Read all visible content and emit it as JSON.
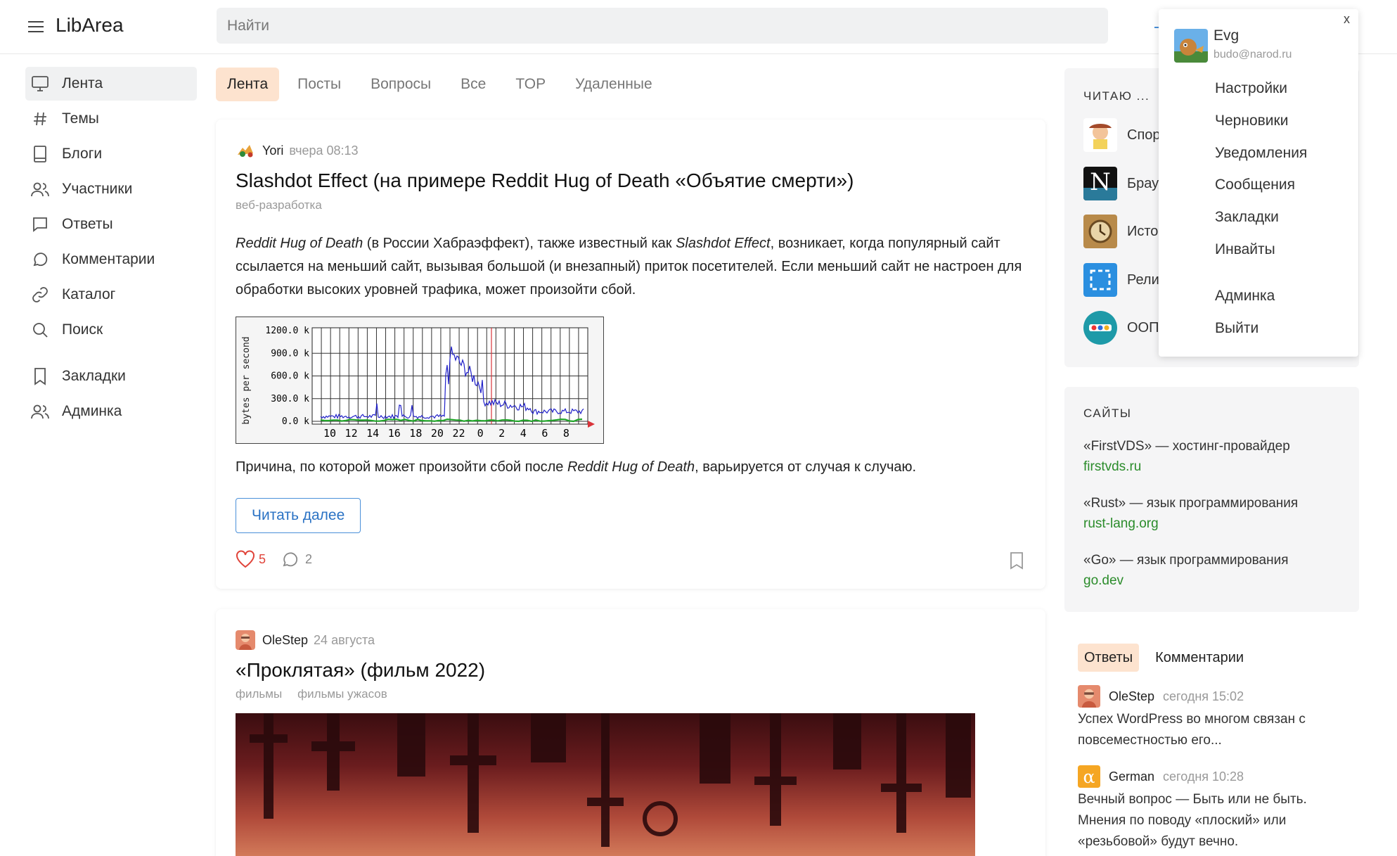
{
  "header": {
    "logo": "LibArea",
    "search_placeholder": "Найти"
  },
  "nav": [
    {
      "label": "Лента",
      "icon": "monitor-icon",
      "active": true
    },
    {
      "label": "Темы",
      "icon": "hash-icon"
    },
    {
      "label": "Блоги",
      "icon": "book-icon"
    },
    {
      "label": "Участники",
      "icon": "users-icon"
    },
    {
      "label": "Ответы",
      "icon": "message-square-icon"
    },
    {
      "label": "Комментарии",
      "icon": "message-circle-icon"
    },
    {
      "label": "Каталог",
      "icon": "link-icon"
    },
    {
      "label": "Поиск",
      "icon": "search-icon"
    },
    {
      "label": "Закладки",
      "icon": "bookmark-icon"
    },
    {
      "label": "Админка",
      "icon": "users-icon"
    }
  ],
  "tabs": [
    "Лента",
    "Посты",
    "Вопросы",
    "Все",
    "TOP",
    "Удаленные"
  ],
  "post1": {
    "author": "Yori",
    "date": "вчера 08:13",
    "title": "Slashdot Effect (на примере Reddit Hug of Death «Объятие смерти»)",
    "tag": "веб-разработка",
    "p1_em1": "Reddit Hug of Death",
    "p1_t1": " (в России Хабраэффект), также известный как ",
    "p1_em2": "Slashdot Effect",
    "p1_t2": ", возникает, когда популярный сайт ссылается на меньший сайт, вызывая большой (и внезапный) приток посетителей. Если меньший сайт не настроен для обработки высоких уровней трафика, может произойти сбой.",
    "p2_t1": "Причина, по которой может произойти сбой после ",
    "p2_em": "Reddit Hug of Death",
    "p2_t2": ", варьируется от случая к случаю.",
    "read_more": "Читать далее",
    "likes": "5",
    "comments": "2",
    "graph": {
      "ylabel": "bytes per second",
      "yticks": [
        "1200.0 k",
        "900.0 k",
        "600.0 k",
        "300.0 k",
        "0.0 k"
      ],
      "xticks": [
        "10",
        "12",
        "14",
        "16",
        "18",
        "20",
        "22",
        "0",
        "2",
        "4",
        "6",
        "8"
      ]
    }
  },
  "post2": {
    "author": "OleStep",
    "date": "24 августа",
    "title": "«Проклятая» (фильм 2022)",
    "tags": [
      "фильмы",
      "фильмы ужасов"
    ]
  },
  "right": {
    "reading_title": "ЧИТАЮ ...",
    "reading": [
      "Спор",
      "Брау",
      "Исто",
      "Рели",
      "ООП"
    ],
    "sites_title": "САЙТЫ",
    "sites": [
      {
        "name": "«FirstVDS» — хостинг-провайдер",
        "url": "firstvds.ru"
      },
      {
        "name": "«Rust» — язык программирования",
        "url": "rust-lang.org"
      },
      {
        "name": "«Go» — язык программирования",
        "url": "go.dev"
      }
    ],
    "tabs": [
      "Ответы",
      "Комментарии"
    ],
    "answers": [
      {
        "author": "OleStep",
        "date": "сегодня 15:02",
        "text": "Успех WordPress во многом связан с повсеместностью его..."
      },
      {
        "author": "German",
        "date": "сегодня 10:28",
        "text": "Вечный вопрос — Быть или не быть. Мнения по поводу «плоский» или «резьбовой» будут вечно."
      }
    ]
  },
  "dropdown": {
    "close": "x",
    "user": "Evg",
    "email": "budo@narod.ru",
    "items": [
      "Настройки",
      "Черновики",
      "Уведомления",
      "Сообщения",
      "Закладки",
      "Инвайты",
      "Админка",
      "Выйти"
    ]
  },
  "colors": {
    "accent": "#2a72c4",
    "tab_active": "#fde3cf",
    "like": "#e0443a",
    "site_link": "#2b8c2b"
  }
}
